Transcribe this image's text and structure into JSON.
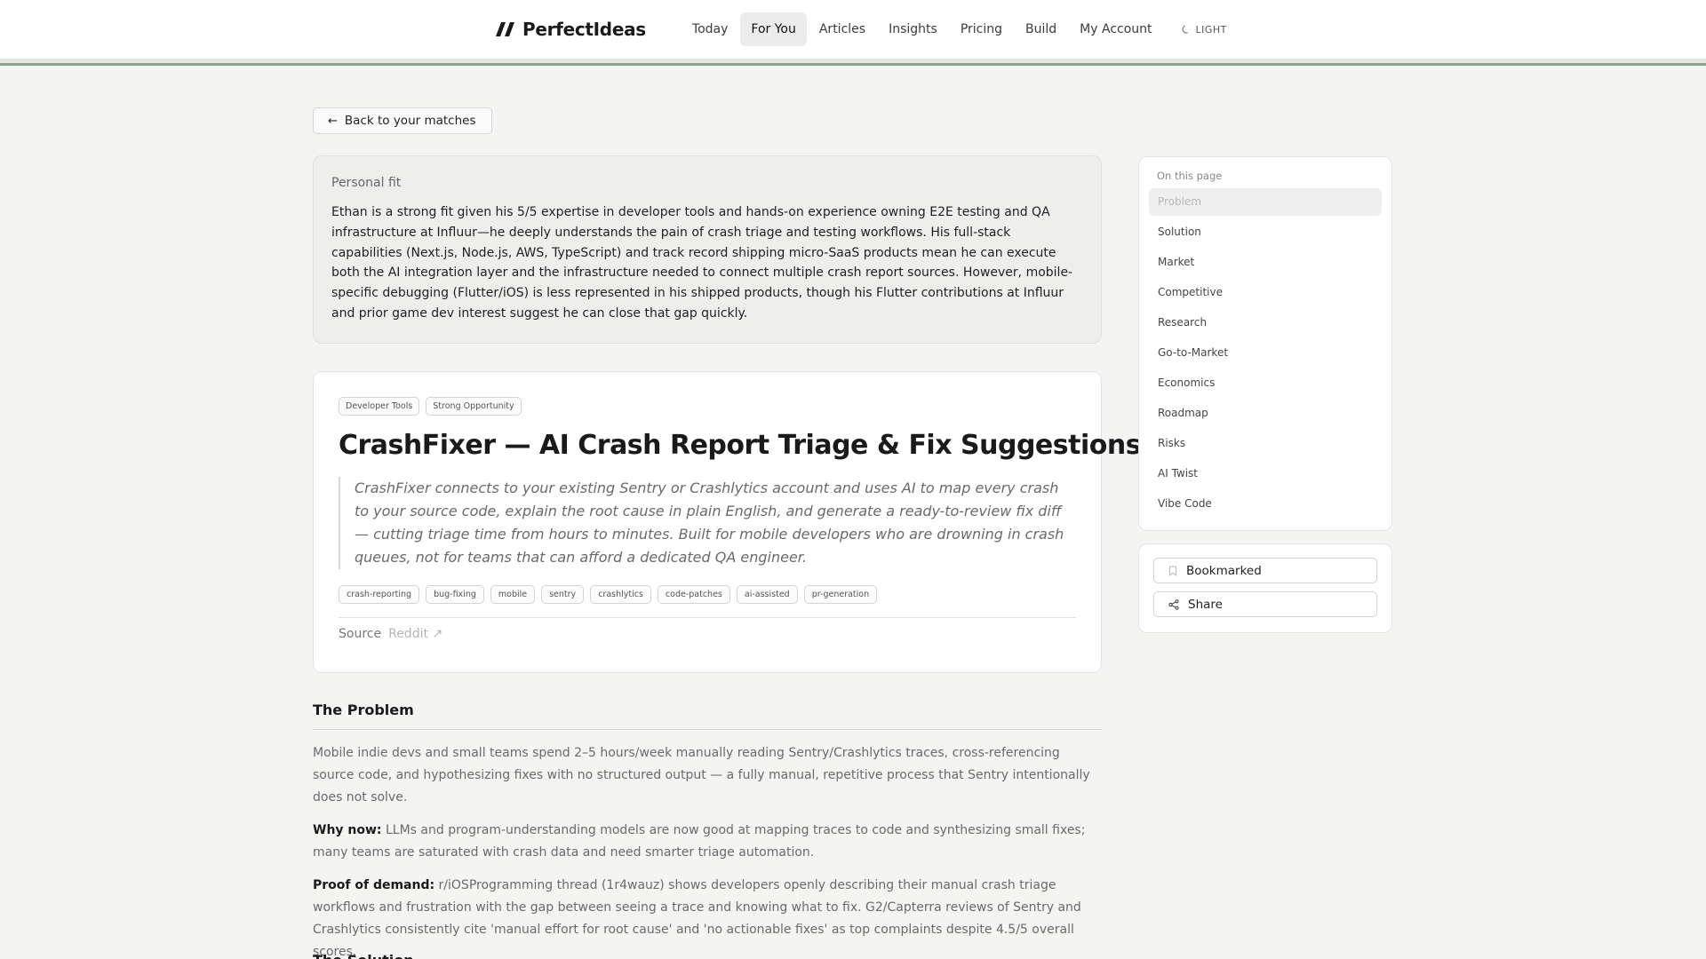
{
  "nav": {
    "brand": "PerfectIdeas",
    "links": [
      "Today",
      "For You",
      "Articles",
      "Insights",
      "Pricing",
      "Build",
      "My Account"
    ],
    "active_index": 1,
    "theme_label": "LIGHT"
  },
  "back_button": "Back to your matches",
  "fit": {
    "label": "Personal fit",
    "text": "Ethan is a strong fit given his 5/5 expertise in developer tools and hands-on experience owning E2E testing and QA infrastructure at Influur—he deeply understands the pain of crash triage and testing workflows. His full-stack capabilities (Next.js, Node.js, AWS, TypeScript) and track record shipping micro-SaaS products mean he can execute both the AI integration layer and the infrastructure needed to connect multiple crash report sources. However, mobile-specific debugging (Flutter/iOS) is less represented in his shipped products, though his Flutter contributions at Influur and prior game dev interest suggest he can close that gap quickly."
  },
  "idea": {
    "tags": [
      "Developer Tools",
      "Strong Opportunity"
    ],
    "title": "CrashFixer — AI Crash Report Triage & Fix Suggestions",
    "summary": "CrashFixer connects to your existing Sentry or Crashlytics account and uses AI to map every crash to your source code, explain the root cause in plain English, and generate a ready-to-review fix diff — cutting triage time from hours to minutes. Built for mobile developers who are drowning in crash queues, not for teams that can afford a dedicated QA engineer.",
    "keywords": [
      "crash-reporting",
      "bug-fixing",
      "mobile",
      "sentry",
      "crashlytics",
      "code-patches",
      "ai-assisted",
      "pr-generation"
    ],
    "source_label": "Source",
    "source_link": "Reddit ↗"
  },
  "problem": {
    "title": "The Problem",
    "intro": "Mobile indie devs and small teams spend 2–5 hours/week manually reading Sentry/Crashlytics traces, cross-referencing source code, and hypothesizing fixes with no structured output — a fully manual, repetitive process that Sentry intentionally does not solve.",
    "why_now_label": "Why now:",
    "why_now": " LLMs and program-understanding models are now good at mapping traces to code and synthesizing small fixes; many teams are saturated with crash data and need smarter triage automation.",
    "proof_label": "Proof of demand:",
    "proof": " r/iOSProgramming thread (1r4wauz) shows developers openly describing their manual crash triage workflows and frustration with the gap between seeing a trace and knowing what to fix. G2/Capterra reviews of Sentry and Crashlytics consistently cite 'manual effort for root cause' and 'no actionable fixes' as top complaints despite 4.5/5 overall scores."
  },
  "next_section_title": "The Solution",
  "toc": {
    "heading": "On this page",
    "items": [
      "Problem",
      "Solution",
      "Market",
      "Competitive",
      "Research",
      "Go-to-Market",
      "Economics",
      "Roadmap",
      "Risks",
      "AI Twist",
      "Vibe Code"
    ],
    "active_index": 0
  },
  "actions": {
    "bookmark": "Bookmarked",
    "share": "Share"
  },
  "colors": {
    "accent_line": "#86a886",
    "page_bg": "#f4f4f2"
  }
}
